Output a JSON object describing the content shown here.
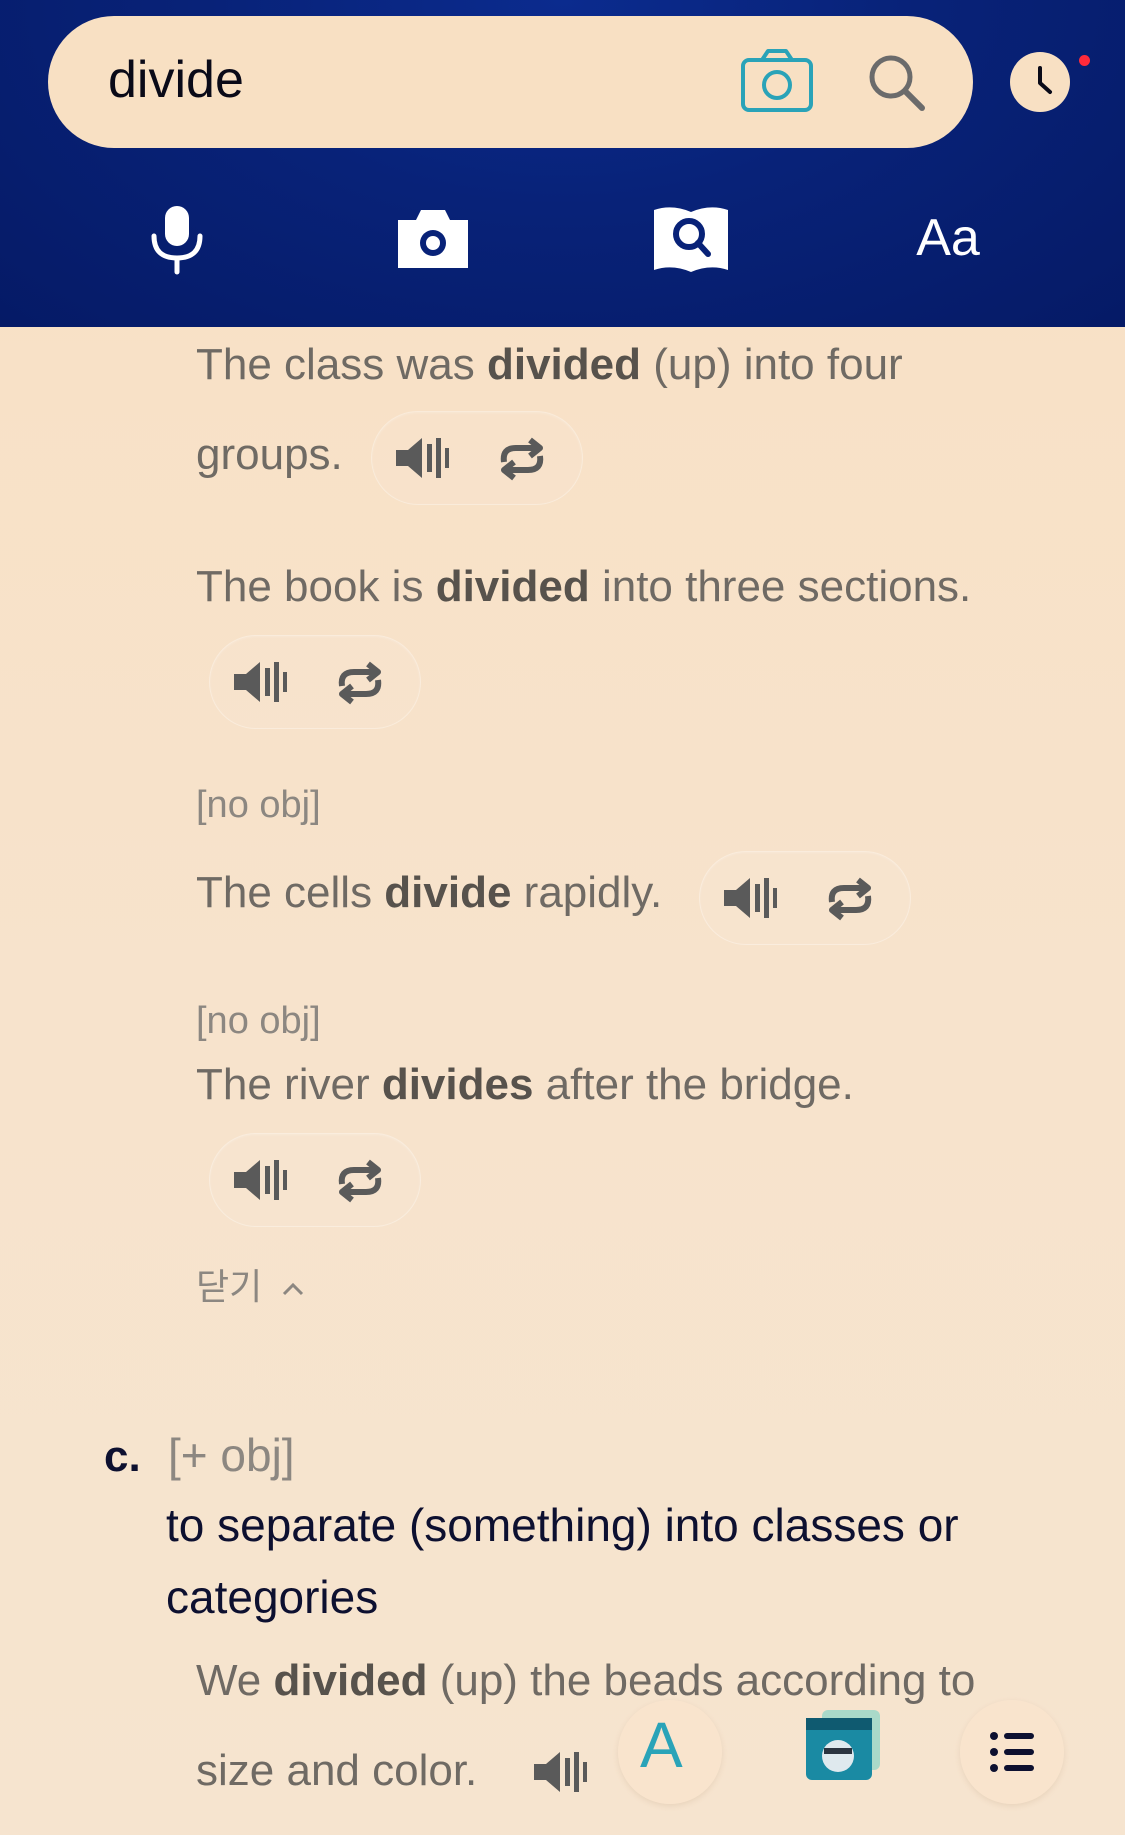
{
  "search": {
    "query": "divide"
  },
  "icons": {
    "camera": "camera-outline-icon",
    "search": "magnifier-icon",
    "history": "clock-icon",
    "mic": "microphone-icon",
    "photo": "camera-icon",
    "book_search": "book-search-icon"
  },
  "toolbar": {
    "font_label": "Aa"
  },
  "examples": [
    {
      "pre": "The class was ",
      "bold": "divided",
      "post": " (up) into four"
    },
    {
      "pre": "groups.",
      "bold": "",
      "post": ""
    },
    {
      "pre": "The book is ",
      "bold": "divided",
      "post": " into three sections."
    },
    {
      "tag": "[no obj]"
    },
    {
      "pre": "The cells ",
      "bold": "divide",
      "post": " rapidly."
    },
    {
      "tag": "[no obj]"
    },
    {
      "pre": "The river ",
      "bold": "divides",
      "post": " after the bridge."
    }
  ],
  "close_label": "닫기",
  "sense_c": {
    "letter": "c.",
    "grammar": "[+ obj]",
    "definition_line1": "to separate (something) into classes or",
    "definition_line2": "categories",
    "example_pre": "We ",
    "example_bold": "divided",
    "example_post": " (up) the beads according to",
    "example_line2": "size and color."
  },
  "bottom_bar": {
    "letter_button": "A"
  },
  "colors": {
    "header_blue": "#082278",
    "pill_beige": "#f8e0c3",
    "teal": "#2aa3b8",
    "text_dark": "#0d1030",
    "text_gray": "#6f6a64"
  }
}
